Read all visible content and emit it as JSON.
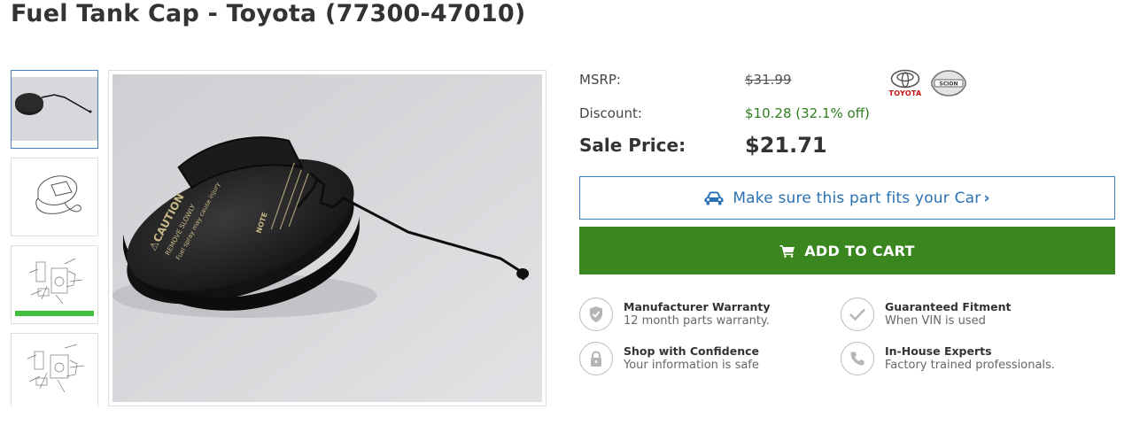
{
  "page": {
    "title": "Fuel Tank Cap - Toyota (77300-47010)"
  },
  "gallery": {
    "thumbnails": [
      {
        "name": "photo"
      },
      {
        "name": "line-drawing"
      },
      {
        "name": "diagram-1"
      },
      {
        "name": "diagram-2"
      }
    ],
    "main_image": "fuel tank cap photo",
    "cap_text": {
      "caution": "⚠CAUTION",
      "line1": "REMOVE SLOWLY",
      "line2": "Fuel spray may cause injury",
      "note_label": "NOTE"
    }
  },
  "pricing": {
    "msrp_label": "MSRP:",
    "msrp_value": "$31.99",
    "discount_label": "Discount:",
    "discount_value": "$10.28 (32.1% off)",
    "sale_label": "Sale Price:",
    "sale_value": "$21.71"
  },
  "brands": {
    "toyota": "TOYOTA",
    "scion": "SCION"
  },
  "fitment_button": {
    "label": "Make sure this part fits your Car",
    "chevron": "›",
    "icon": "car-icon"
  },
  "cart_button": {
    "label": "ADD TO CART",
    "icon": "cart-icon"
  },
  "features": [
    {
      "title": "Manufacturer Warranty",
      "subtitle": "12 month parts warranty.",
      "icon": "shield-icon"
    },
    {
      "title": "Guaranteed Fitment",
      "subtitle": "When VIN is used",
      "icon": "check-icon"
    },
    {
      "title": "Shop with Confidence",
      "subtitle": "Your information is safe",
      "icon": "lock-icon"
    },
    {
      "title": "In-House Experts",
      "subtitle": "Factory trained professionals.",
      "icon": "phone-icon"
    }
  ],
  "colors": {
    "discount": "#2e7d1e",
    "cart_button": "#3a861f",
    "fit_button_border": "#3a7fc1",
    "fit_button_text": "#2a72b5"
  }
}
